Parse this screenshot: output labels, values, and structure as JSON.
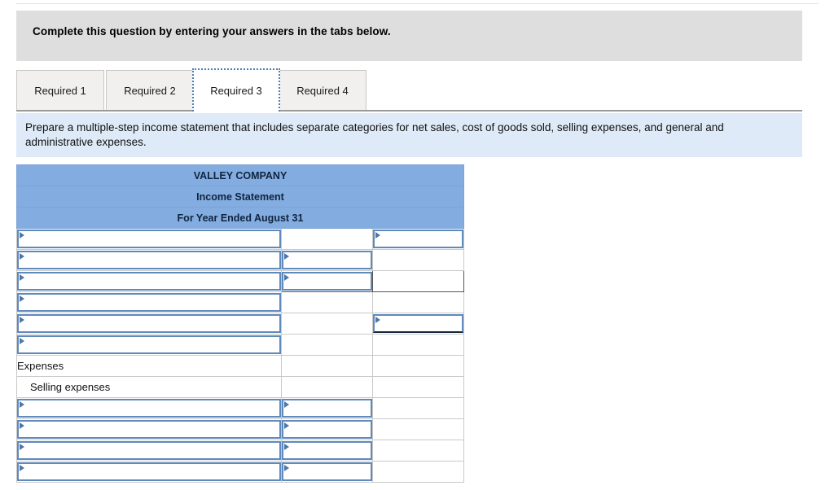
{
  "banner": {
    "text": "Complete this question by entering your answers in the tabs below."
  },
  "tabs": {
    "items": [
      {
        "label": "Required 1",
        "active": false
      },
      {
        "label": "Required 2",
        "active": false
      },
      {
        "label": "Required 3",
        "active": true
      },
      {
        "label": "Required 4",
        "active": false
      }
    ]
  },
  "instruction": {
    "text": "Prepare a multiple-step income statement that includes separate categories for net sales, cost of goods sold, selling expenses, and general and administrative expenses."
  },
  "statement": {
    "title_lines": [
      "VALLEY COMPANY",
      "Income Statement",
      "For Year Ended August 31"
    ],
    "header_color": "#83ace0",
    "input_border_color": "#6089bc",
    "rows": [
      {
        "desc": "",
        "desc_input": true,
        "a": "",
        "a_input": false,
        "b": "",
        "b_input": true,
        "b_underline": false,
        "a_dark": false,
        "b_dark": false
      },
      {
        "desc": "",
        "desc_input": true,
        "a": "",
        "a_input": true,
        "b": "",
        "b_input": false,
        "b_underline": false,
        "a_dark": false,
        "b_dark": false
      },
      {
        "desc": "",
        "desc_input": true,
        "a": "",
        "a_input": true,
        "b": "",
        "b_input": false,
        "b_underline": false,
        "a_dark": true,
        "b_dark": true
      },
      {
        "desc": "",
        "desc_input": true,
        "a": "",
        "a_input": false,
        "b": "",
        "b_input": false,
        "b_underline": false,
        "a_dark": false,
        "b_dark": false
      },
      {
        "desc": "",
        "desc_input": true,
        "a": "",
        "a_input": false,
        "b": "",
        "b_input": true,
        "b_underline": true,
        "a_dark": false,
        "b_dark": false
      },
      {
        "desc": "",
        "desc_input": true,
        "a": "",
        "a_input": false,
        "b": "",
        "b_input": false,
        "b_underline": false,
        "a_dark": false,
        "b_dark": false
      },
      {
        "desc": "Expenses",
        "desc_input": false,
        "indent": false,
        "a": "",
        "a_input": false,
        "b": "",
        "b_input": false,
        "b_underline": false,
        "a_dark": false,
        "b_dark": false
      },
      {
        "desc": "Selling expenses",
        "desc_input": false,
        "indent": true,
        "a": "",
        "a_input": false,
        "b": "",
        "b_input": false,
        "b_underline": false,
        "a_dark": false,
        "b_dark": false
      },
      {
        "desc": "",
        "desc_input": true,
        "a": "",
        "a_input": true,
        "b": "",
        "b_input": false,
        "b_underline": false,
        "a_dark": false,
        "b_dark": false
      },
      {
        "desc": "",
        "desc_input": true,
        "a": "",
        "a_input": true,
        "b": "",
        "b_input": false,
        "b_underline": false,
        "a_dark": false,
        "b_dark": false
      },
      {
        "desc": "",
        "desc_input": true,
        "a": "",
        "a_input": true,
        "b": "",
        "b_input": false,
        "b_underline": false,
        "a_dark": false,
        "b_dark": false
      },
      {
        "desc": "",
        "desc_input": true,
        "a": "",
        "a_input": true,
        "b": "",
        "b_input": false,
        "b_underline": false,
        "a_dark": false,
        "b_dark": false
      }
    ]
  }
}
